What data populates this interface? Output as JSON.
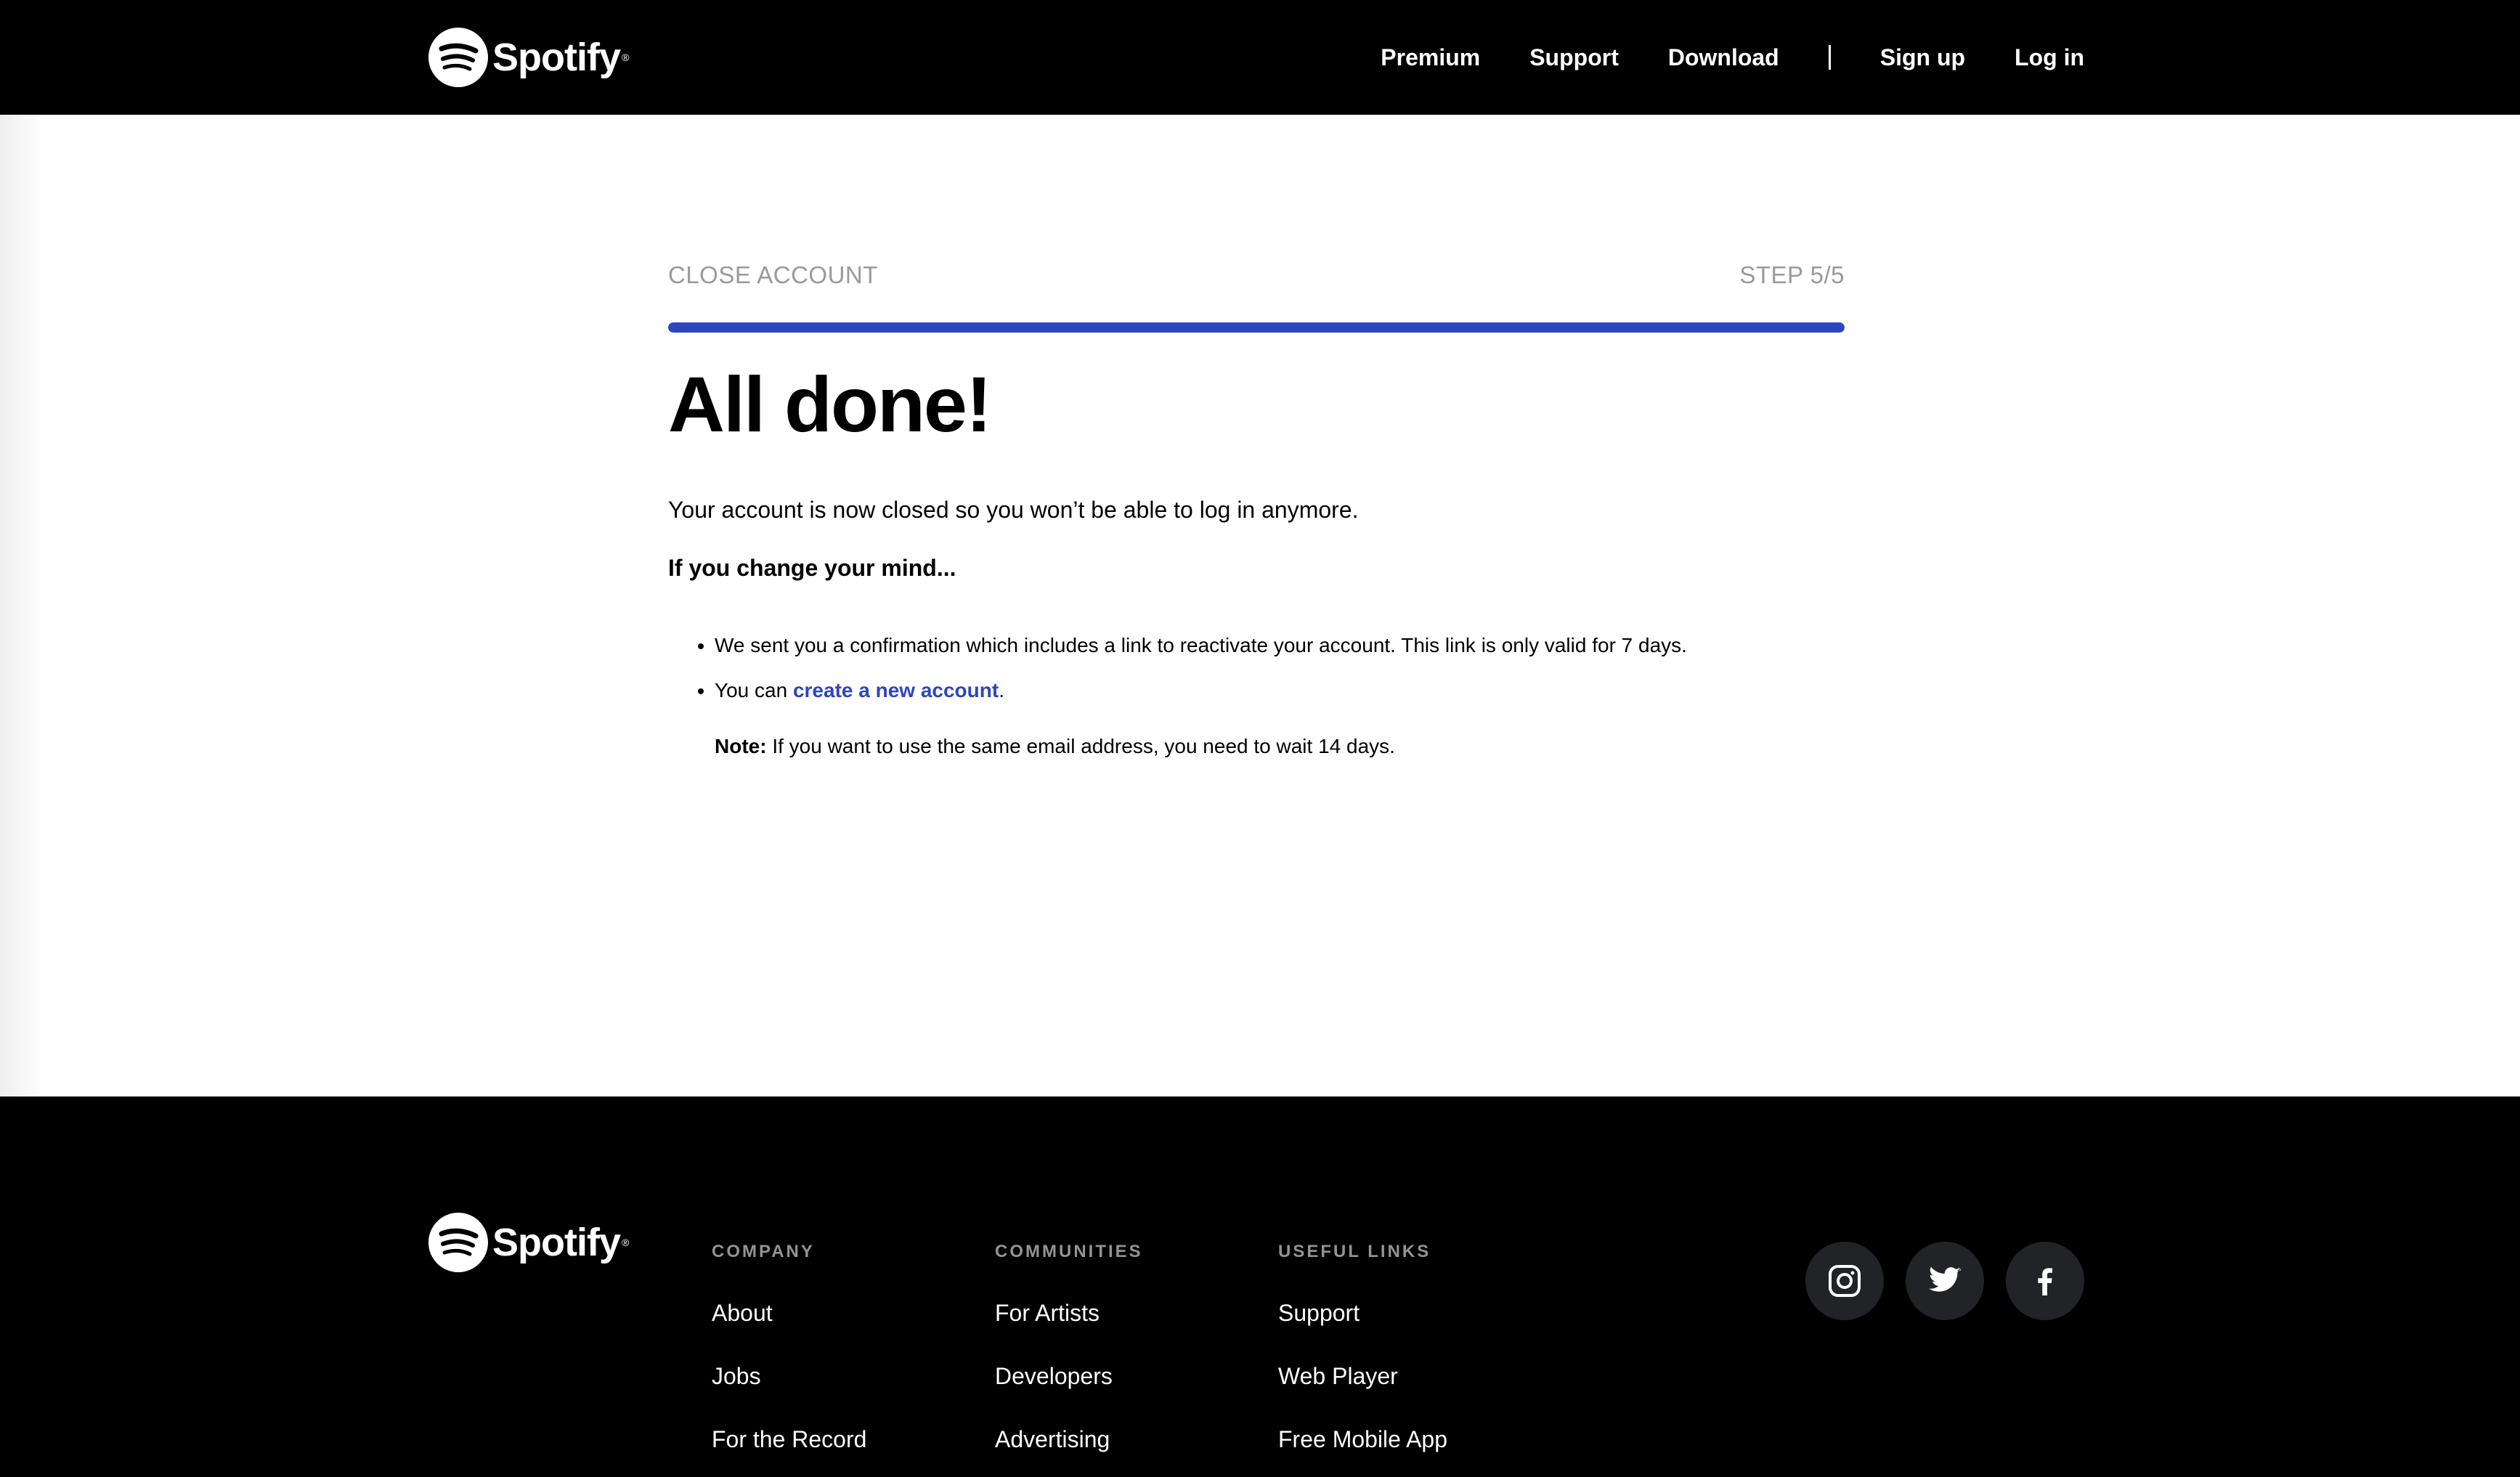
{
  "header": {
    "brand": "Spotify",
    "nav": {
      "premium": "Premium",
      "support": "Support",
      "download": "Download",
      "signup": "Sign up",
      "login": "Log in"
    }
  },
  "main": {
    "step_label": "CLOSE ACCOUNT",
    "step_count": "STEP 5/5",
    "progress_fraction": 1.0,
    "title": "All done!",
    "closed_text": "Your account is now closed so you won’t be able to log in anymore.",
    "change_mind": "If you change your mind...",
    "bullet1": "We sent you a confirmation which includes a link to reactivate your account. This link is only valid for 7 days.",
    "bullet2_prefix": "You can ",
    "bullet2_link": "create a new account",
    "bullet2_suffix": ".",
    "note_label": "Note:",
    "note_text": " If you want to use the same email address, you need to wait 14 days."
  },
  "footer": {
    "brand": "Spotify",
    "company": {
      "heading": "COMPANY",
      "links": [
        "About",
        "Jobs",
        "For the Record"
      ]
    },
    "communities": {
      "heading": "COMMUNITIES",
      "links": [
        "For Artists",
        "Developers",
        "Advertising"
      ]
    },
    "useful": {
      "heading": "USEFUL LINKS",
      "links": [
        "Support",
        "Web Player",
        "Free Mobile App"
      ]
    },
    "socials": [
      "instagram-icon",
      "twitter-icon",
      "facebook-icon"
    ]
  },
  "colors": {
    "accent": "#2d46b9",
    "header_bg": "#000000",
    "muted": "#9a9a9a"
  }
}
